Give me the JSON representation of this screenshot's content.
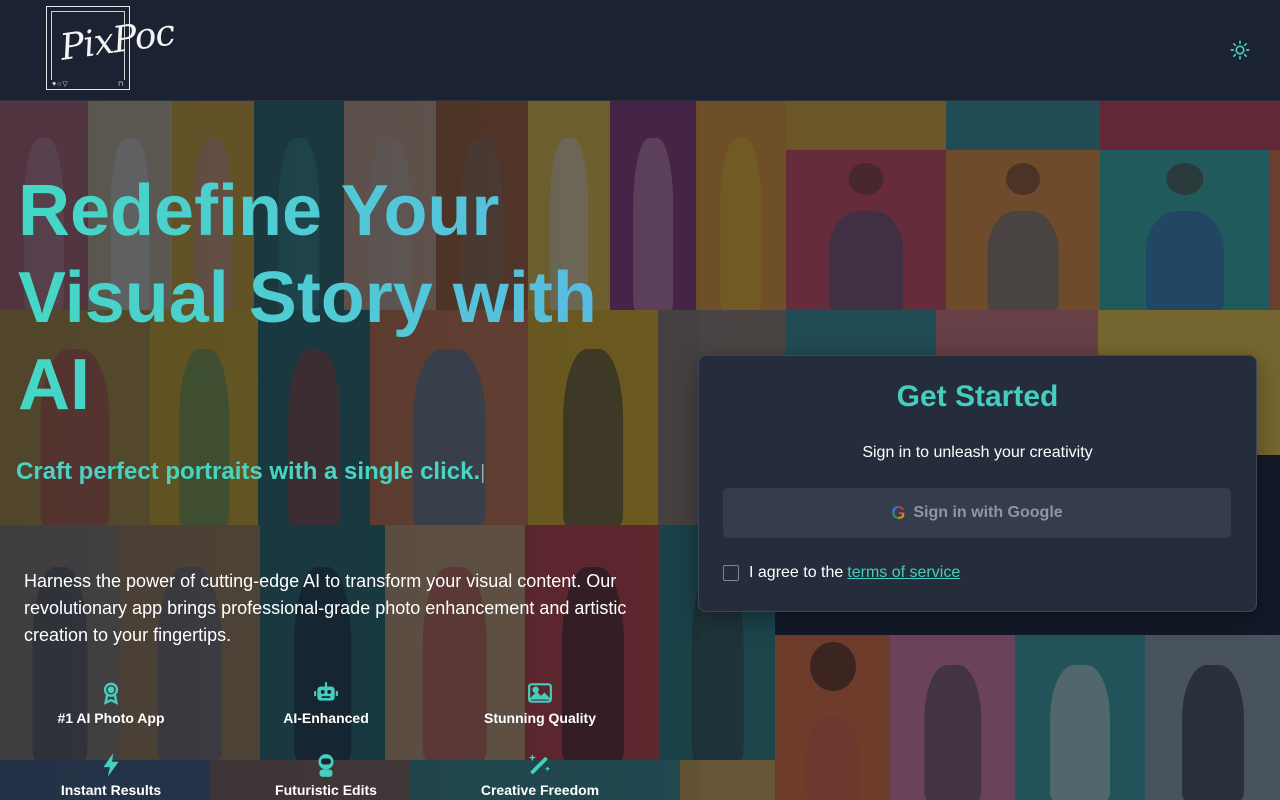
{
  "brand": {
    "logo_text": "PixPoc"
  },
  "header": {
    "theme_toggle_icon": "sun-icon"
  },
  "hero": {
    "title_line1": "Redefine Your",
    "title_line2": "Visual Story with",
    "title_line3": "AI",
    "subtitle": "Craft perfect portraits with a single click.",
    "description": "Harness the power of cutting-edge AI to transform your visual content. Our revolutionary app brings professional-grade photo enhancement and artistic creation to your fingertips."
  },
  "features": [
    {
      "label": "#1 AI Photo App",
      "icon": "award-icon"
    },
    {
      "label": "AI-Enhanced",
      "icon": "robot-icon"
    },
    {
      "label": "Stunning Quality",
      "icon": "image-icon"
    },
    {
      "label": "Instant Results",
      "icon": "lightning-icon"
    },
    {
      "label": "Futuristic Edits",
      "icon": "astronaut-icon"
    },
    {
      "label": "Creative Freedom",
      "icon": "magic-wand-icon"
    }
  ],
  "card": {
    "title": "Get Started",
    "subtitle": "Sign in to unleash your creativity",
    "google_button_label": "Sign in with Google",
    "agree_text": "I agree to the",
    "terms_link": "terms of service",
    "agree_checked": false
  },
  "colors": {
    "accent": "#45cdbe",
    "background": "#1a2130",
    "card": "#252d3c"
  }
}
